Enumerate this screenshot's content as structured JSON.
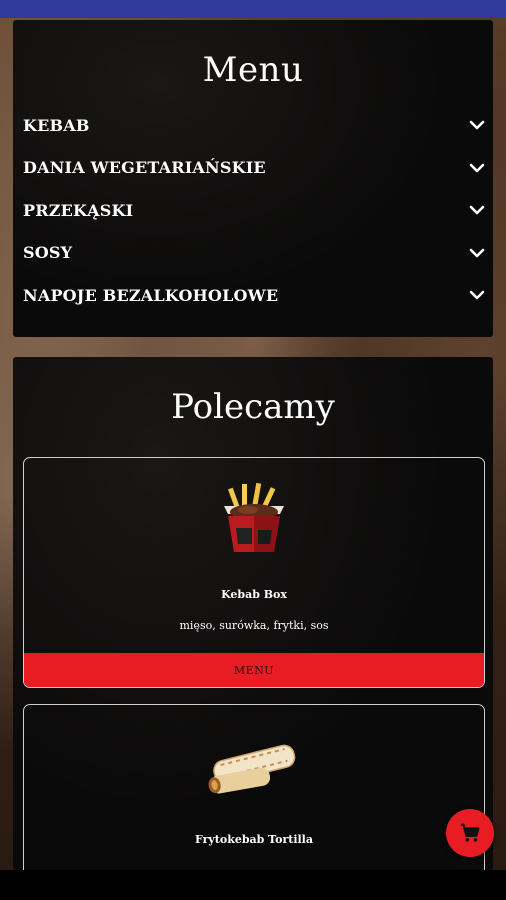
{
  "menu": {
    "title": "Menu",
    "items": [
      {
        "label": "KEBAB"
      },
      {
        "label": "DANIA WEGETARIAŃSKIE"
      },
      {
        "label": "PRZEKĄSKI"
      },
      {
        "label": "SOSY"
      },
      {
        "label": "NAPOJE BEZALKOHOLOWE"
      }
    ]
  },
  "recommended": {
    "title": "Polecamy",
    "products": [
      {
        "name": "Kebab Box",
        "description": "mięso, surówka, frytki, sos",
        "button_label": "MENU"
      },
      {
        "name": "Frytokebab Tortilla"
      }
    ]
  },
  "icons": {
    "chevron": "chevron-down-icon",
    "cart": "cart-icon"
  },
  "colors": {
    "accent": "#e81c23",
    "status_bar": "#2f3a9a"
  }
}
